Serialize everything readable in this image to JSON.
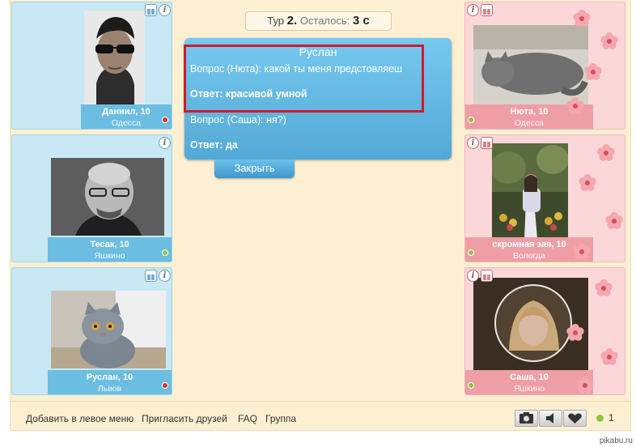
{
  "round": {
    "tour_label": "Тур",
    "tour_number": "2.",
    "remaining_label": "Осталось:",
    "remaining_value": "3 с"
  },
  "question_panel": {
    "title": "Руслан",
    "q1": "Вопрос (Нюта): какой ты меня предстовляеш",
    "a1": "Ответ: красивой умной",
    "q2": "Вопрос (Саша): ня?)",
    "a2": "Ответ: да",
    "close_label": "Закрыть"
  },
  "players_left": [
    {
      "name": "Даниил, 10",
      "city": "Одесса",
      "status": "offline"
    },
    {
      "name": "Тесак, 10",
      "city": "Яшкино",
      "status": "online"
    },
    {
      "name": "Руслан, 10",
      "city": "Львов",
      "status": "offline"
    }
  ],
  "players_right": [
    {
      "name": "Нюта, 10",
      "city": "Одесса",
      "status": "online"
    },
    {
      "name": "скромная зая, 10",
      "city": "Вологда",
      "status": "online"
    },
    {
      "name": "Саша, 10",
      "city": "Яшкино",
      "status": "online"
    }
  ],
  "footer": {
    "links": [
      "Добавить в левое меню",
      "Пригласить друзей",
      "FAQ",
      "Группа"
    ],
    "icons": [
      "camera-icon",
      "speaker-icon",
      "heart-icon"
    ],
    "online_count": "1"
  },
  "watermark": "pikabu.ru",
  "colors": {
    "blue_card": "#c7e8f4",
    "pink_card": "#fbd7d9",
    "panel_bg": "#fdf0d2",
    "highlight": "#d3192e"
  }
}
